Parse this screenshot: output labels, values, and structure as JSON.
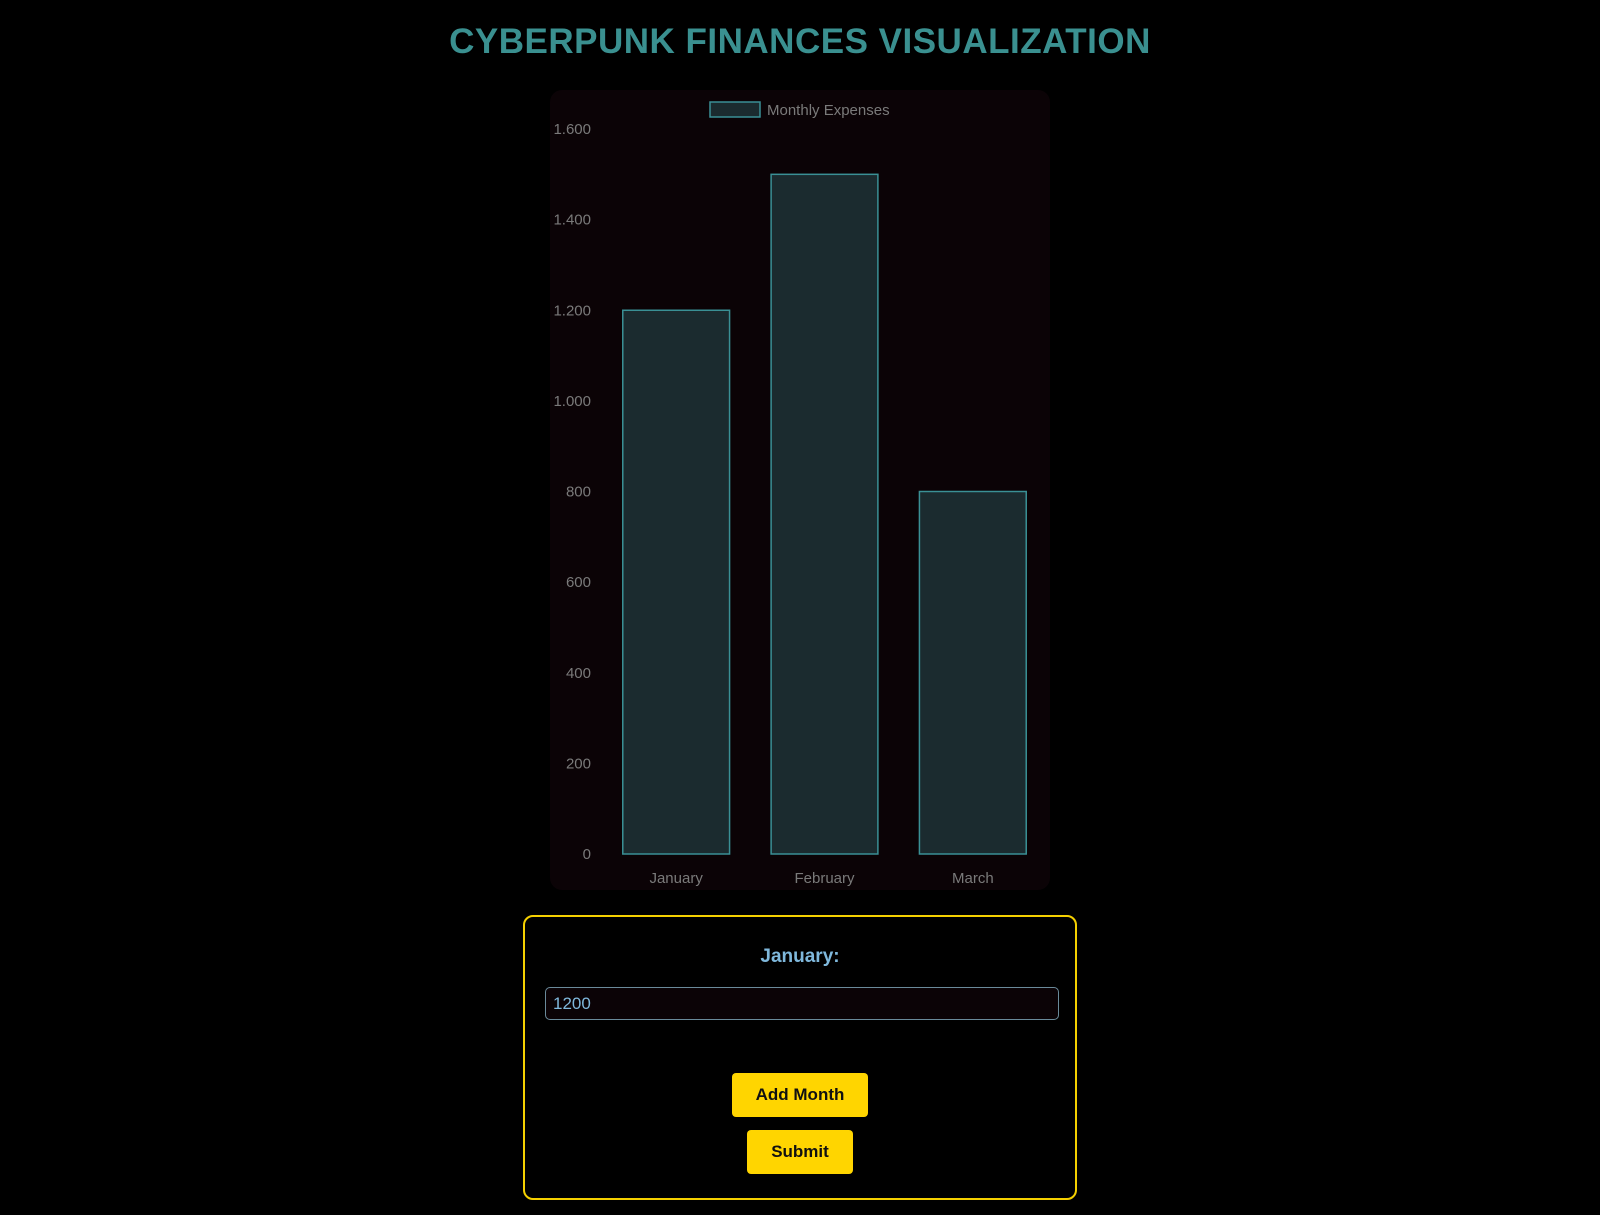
{
  "page": {
    "title": "CYBERPUNK FINANCES VISUALIZATION"
  },
  "colors": {
    "title": "#3a9090",
    "bar_fill": "#1b2b2f",
    "bar_border": "#3a9095",
    "chart_background": "#0b0306",
    "axis_text": "#7a7a7a",
    "form_border": "#f5d000",
    "button_background": "#ffd500",
    "label_text": "#7fb8dc"
  },
  "chart_data": {
    "type": "bar",
    "categories": [
      "January",
      "February",
      "March"
    ],
    "series": [
      {
        "name": "Monthly Expenses",
        "values": [
          1200,
          1500,
          800
        ]
      }
    ],
    "ylim": [
      0,
      1600
    ],
    "y_ticks": [
      "0",
      "200",
      "400",
      "600",
      "800",
      "1.000",
      "1.200",
      "1.400",
      "1.600"
    ],
    "grid": false,
    "legend": "top-center"
  },
  "form": {
    "field_label": "January:",
    "field_value": "1200",
    "add_button_label": "Add Month",
    "submit_button_label": "Submit"
  }
}
